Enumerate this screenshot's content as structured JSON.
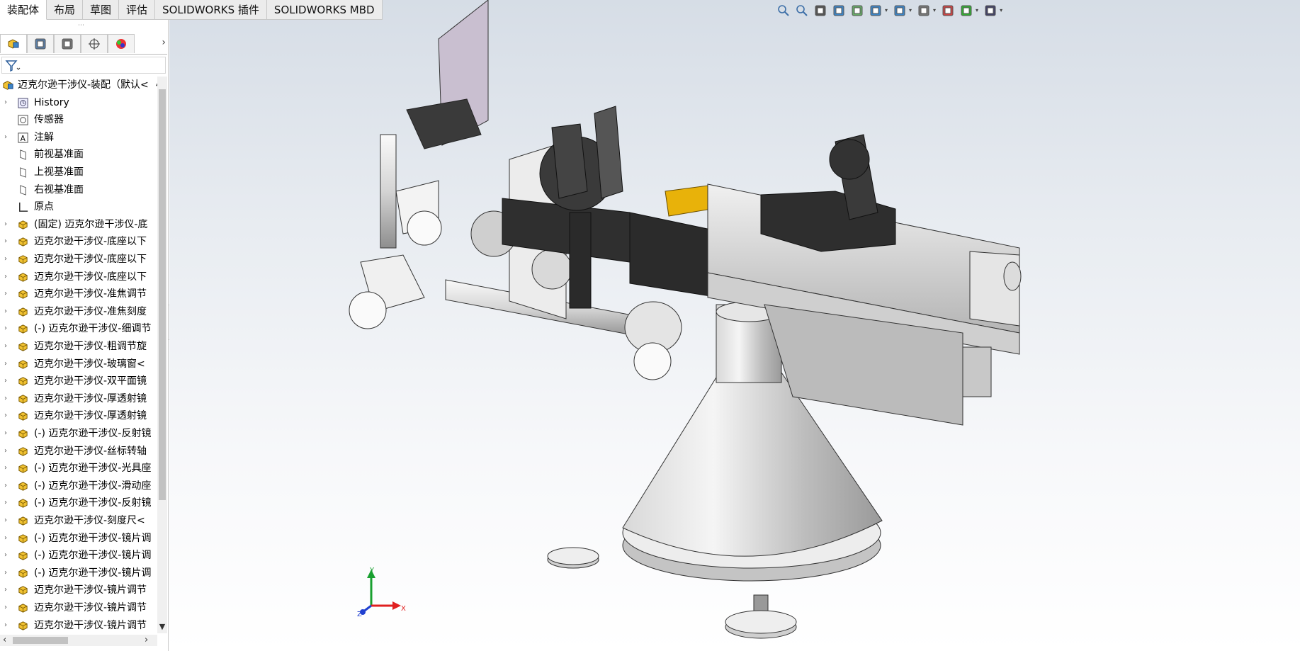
{
  "tabs": [
    {
      "label": "装配体",
      "active": true
    },
    {
      "label": "布局",
      "active": false
    },
    {
      "label": "草图",
      "active": false
    },
    {
      "label": "评估",
      "active": false
    },
    {
      "label": "SOLIDWORKS 插件",
      "active": false
    },
    {
      "label": "SOLIDWORKS MBD",
      "active": false
    }
  ],
  "panel_tabs": [
    "featuremanager-icon",
    "propertymanager-icon",
    "configurationmanager-icon",
    "dimxpert-icon",
    "display-manager-icon"
  ],
  "tree": {
    "root": "迈克尔逊干涉仪-装配（默认<",
    "items": [
      {
        "label": "History",
        "icon": "history-icon",
        "expandable": true
      },
      {
        "label": "传感器",
        "icon": "sensor-icon",
        "expandable": false
      },
      {
        "label": "注解",
        "icon": "annotation-icon",
        "expandable": true
      },
      {
        "label": "前视基准面",
        "icon": "plane-icon",
        "expandable": false
      },
      {
        "label": "上视基准面",
        "icon": "plane-icon",
        "expandable": false
      },
      {
        "label": "右视基准面",
        "icon": "plane-icon",
        "expandable": false
      },
      {
        "label": "原点",
        "icon": "origin-icon",
        "expandable": false
      },
      {
        "label": "(固定) 迈克尔逊干涉仪-底",
        "icon": "part-icon",
        "expandable": true
      },
      {
        "label": "迈克尔逊干涉仪-底座以下",
        "icon": "part-icon",
        "expandable": true
      },
      {
        "label": "迈克尔逊干涉仪-底座以下",
        "icon": "part-icon",
        "expandable": true
      },
      {
        "label": "迈克尔逊干涉仪-底座以下",
        "icon": "part-icon",
        "expandable": true
      },
      {
        "label": "迈克尔逊干涉仪-准焦调节",
        "icon": "part-icon",
        "expandable": true
      },
      {
        "label": "迈克尔逊干涉仪-准焦刻度",
        "icon": "part-icon",
        "expandable": true
      },
      {
        "label": "(-) 迈克尔逊干涉仪-细调节",
        "icon": "part-icon",
        "expandable": true
      },
      {
        "label": "迈克尔逊干涉仪-粗调节旋",
        "icon": "part-icon",
        "expandable": true
      },
      {
        "label": "迈克尔逊干涉仪-玻璃窗<",
        "icon": "part-icon",
        "expandable": true
      },
      {
        "label": "迈克尔逊干涉仪-双平面镜",
        "icon": "part-icon",
        "expandable": true
      },
      {
        "label": "迈克尔逊干涉仪-厚透射镜",
        "icon": "part-icon",
        "expandable": true
      },
      {
        "label": "迈克尔逊干涉仪-厚透射镜",
        "icon": "part-icon",
        "expandable": true
      },
      {
        "label": "(-) 迈克尔逊干涉仪-反射镜",
        "icon": "part-icon",
        "expandable": true
      },
      {
        "label": "迈克尔逊干涉仪-丝标转轴",
        "icon": "part-icon",
        "expandable": true
      },
      {
        "label": "(-) 迈克尔逊干涉仪-光具座",
        "icon": "part-icon",
        "expandable": true
      },
      {
        "label": "(-) 迈克尔逊干涉仪-滑动座",
        "icon": "part-icon",
        "expandable": true
      },
      {
        "label": "(-) 迈克尔逊干涉仪-反射镜",
        "icon": "part-icon",
        "expandable": true
      },
      {
        "label": "迈克尔逊干涉仪-刻度尺<",
        "icon": "part-icon",
        "expandable": true
      },
      {
        "label": "(-) 迈克尔逊干涉仪-镜片调",
        "icon": "part-icon",
        "expandable": true
      },
      {
        "label": "(-) 迈克尔逊干涉仪-镜片调",
        "icon": "part-icon",
        "expandable": true
      },
      {
        "label": "(-) 迈克尔逊干涉仪-镜片调",
        "icon": "part-icon",
        "expandable": true
      },
      {
        "label": "迈克尔逊干涉仪-镜片调节",
        "icon": "part-icon",
        "expandable": true
      },
      {
        "label": "迈克尔逊干涉仪-镜片调节",
        "icon": "part-icon",
        "expandable": true
      },
      {
        "label": "迈克尔逊干涉仪-镜片调节",
        "icon": "part-icon",
        "expandable": true
      },
      {
        "label": "迈克尔逊干涉仪-镜片调节",
        "icon": "part-icon",
        "expandable": true
      }
    ]
  },
  "hud_tools": [
    "zoom-to-fit-icon",
    "zoom-to-area-icon",
    "previous-view-icon",
    "section-view-icon",
    "dynamic-annotation-icon",
    "view-orientation-icon",
    "display-style-icon",
    "hide-show-items-icon",
    "edit-appearance-icon",
    "apply-scene-icon",
    "view-settings-icon"
  ],
  "task_pane": [
    "home-icon",
    "design-library-icon",
    "file-explorer-icon",
    "view-palette-icon",
    "appearances-icon",
    "custom-properties-icon",
    "forum-icon"
  ],
  "triad": {
    "x": "X",
    "y": "Y",
    "z": "Z"
  },
  "colors": {
    "accent_yellow": "#e8b20a",
    "part_dark": "#333333",
    "part_light": "#d9d9d9",
    "plate": "#c9bfd0"
  }
}
